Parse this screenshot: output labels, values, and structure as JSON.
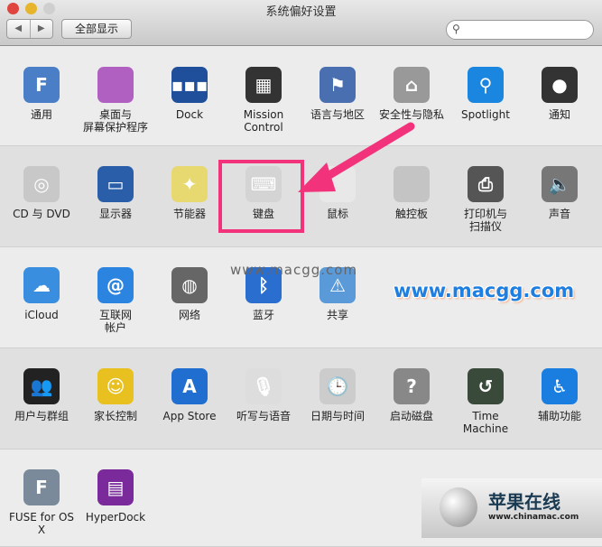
{
  "window": {
    "title": "系统偏好设置"
  },
  "toolbar": {
    "back": "◀",
    "forward": "▶",
    "show_all": "全部显示",
    "search_placeholder": ""
  },
  "rows": [
    [
      {
        "label": "通用",
        "icon": "general-icon",
        "color": "#4a7fc8",
        "glyph": "F"
      },
      {
        "label": "桌面与\n屏幕保护程序",
        "icon": "desktop-icon",
        "color": "#b060c0",
        "glyph": ""
      },
      {
        "label": "Dock",
        "icon": "dock-icon",
        "color": "#1f4f9a",
        "glyph": "▪▪▪"
      },
      {
        "label": "Mission\nControl",
        "icon": "mission-control-icon",
        "color": "#333",
        "glyph": "▦"
      },
      {
        "label": "语言与地区",
        "icon": "flag-icon",
        "color": "#4a6fb0",
        "glyph": "⚑"
      },
      {
        "label": "安全性与隐私",
        "icon": "security-house-icon",
        "color": "#999",
        "glyph": "⌂"
      },
      {
        "label": "Spotlight",
        "icon": "spotlight-icon",
        "color": "#1a86e0",
        "glyph": "⚲"
      },
      {
        "label": "通知",
        "icon": "notifications-icon",
        "color": "#333",
        "glyph": "●"
      }
    ],
    [
      {
        "label": "CD 与 DVD",
        "icon": "cd-icon",
        "color": "#c8c8c8",
        "glyph": "◎"
      },
      {
        "label": "显示器",
        "icon": "display-icon",
        "color": "#2a5ea8",
        "glyph": "▭"
      },
      {
        "label": "节能器",
        "icon": "lightbulb-icon",
        "color": "#e8d870",
        "glyph": "✦"
      },
      {
        "label": "键盘",
        "icon": "keyboard-icon",
        "color": "#d4d4d4",
        "glyph": "⌨"
      },
      {
        "label": "鼠标",
        "icon": "mouse-icon",
        "color": "#e8e8e8",
        "glyph": ""
      },
      {
        "label": "触控板",
        "icon": "trackpad-icon",
        "color": "#c4c4c4",
        "glyph": ""
      },
      {
        "label": "打印机与\n扫描仪",
        "icon": "printer-icon",
        "color": "#555",
        "glyph": "⎙"
      },
      {
        "label": "声音",
        "icon": "speaker-icon",
        "color": "#777",
        "glyph": "🔈"
      }
    ],
    [
      {
        "label": "iCloud",
        "icon": "icloud-icon",
        "color": "#3a8ee0",
        "glyph": "☁"
      },
      {
        "label": "互联网\n帐户",
        "icon": "internet-accounts-icon",
        "color": "#2a84e0",
        "glyph": "@"
      },
      {
        "label": "网络",
        "icon": "network-globe-icon",
        "color": "#666",
        "glyph": "◍"
      },
      {
        "label": "蓝牙",
        "icon": "bluetooth-icon",
        "color": "#2a6ed0",
        "glyph": "ᛒ"
      },
      {
        "label": "共享",
        "icon": "sharing-icon",
        "color": "#5a9ad8",
        "glyph": "⚠"
      }
    ],
    [
      {
        "label": "用户与群组",
        "icon": "users-icon",
        "color": "#222",
        "glyph": "👥"
      },
      {
        "label": "家长控制",
        "icon": "parental-controls-icon",
        "color": "#e8c020",
        "glyph": "☺"
      },
      {
        "label": "App Store",
        "icon": "app-store-icon",
        "color": "#1f6ed0",
        "glyph": "A"
      },
      {
        "label": "听写与语音",
        "icon": "microphone-icon",
        "color": "#ddd",
        "glyph": "🎙"
      },
      {
        "label": "日期与时间",
        "icon": "clock-icon",
        "color": "#ccc",
        "glyph": "🕒"
      },
      {
        "label": "启动磁盘",
        "icon": "startup-disk-icon",
        "color": "#888",
        "glyph": "?"
      },
      {
        "label": "Time Machine",
        "icon": "time-machine-icon",
        "color": "#3a4a3a",
        "glyph": "↺"
      },
      {
        "label": "辅助功能",
        "icon": "accessibility-icon",
        "color": "#1a7ee0",
        "glyph": "♿"
      }
    ],
    [
      {
        "label": "FUSE for OS X",
        "icon": "fuse-icon",
        "color": "#7a8a9a",
        "glyph": "F"
      },
      {
        "label": "HyperDock",
        "icon": "hyperdock-icon",
        "color": "#7a2a9a",
        "glyph": "▤"
      }
    ]
  ],
  "watermarks": {
    "small": "www.macgg.com",
    "large": "www.macgg.com"
  },
  "logo": {
    "name": "苹果在线",
    "url": "www.chinamac.com"
  },
  "colors": {
    "highlight": "#f2337c",
    "watermark": "#1e7fe0"
  }
}
